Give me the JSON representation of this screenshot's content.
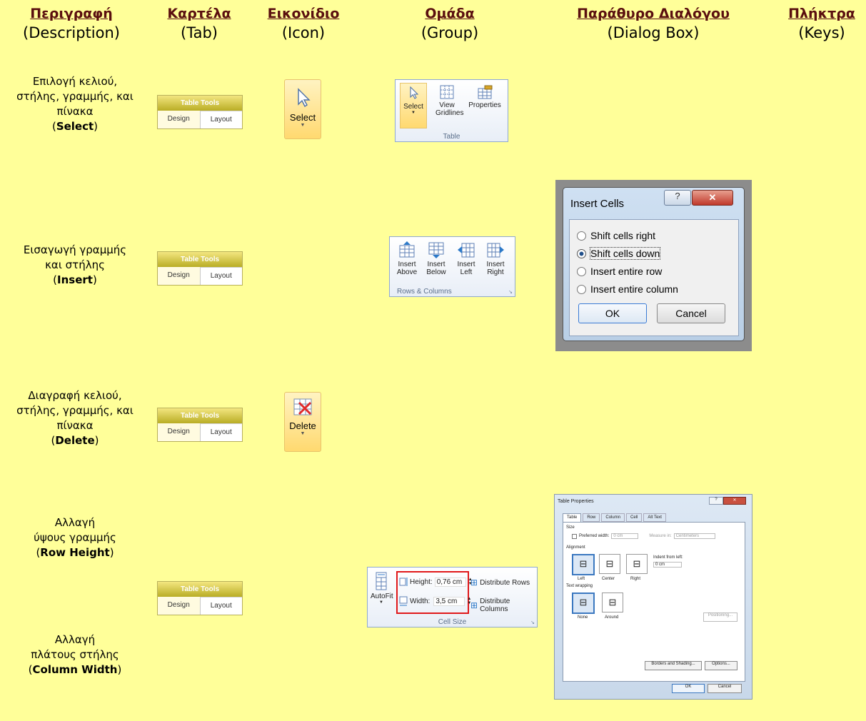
{
  "headers": [
    {
      "title": "Περιγραφή",
      "sub": "(Description)"
    },
    {
      "title": "Καρτέλα",
      "sub": "(Tab)"
    },
    {
      "title": "Εικονίδιο",
      "sub": "(Icon)"
    },
    {
      "title": "Ομάδα",
      "sub": "(Group)"
    },
    {
      "title": "Παράθυρο Διαλόγου",
      "sub": "(Dialog Box)"
    },
    {
      "title": "Πλήκτρα",
      "sub": "(Keys)"
    }
  ],
  "rows": [
    {
      "lines": [
        "Επιλογή κελιού,",
        "στήλης, γραμμής, και",
        "πίνακα"
      ],
      "key": "Select"
    },
    {
      "lines": [
        "Εισαγωγή γραμμής",
        "και στήλης"
      ],
      "key": "Insert"
    },
    {
      "lines": [
        "Διαγραφή κελιού,",
        "στήλης, γραμμής, και",
        "πίνακα"
      ],
      "key": "Delete"
    },
    {
      "lines": [
        "Αλλαγή",
        "ύψους γραμμής"
      ],
      "key": "Row Height"
    },
    {
      "lines": [
        "Αλλαγή",
        "πλάτους στήλης"
      ],
      "key": "Column Width"
    }
  ],
  "tab_tools": {
    "title": "Table Tools",
    "design": "Design",
    "layout": "Layout"
  },
  "icons": {
    "select": "Select",
    "delete": "Delete"
  },
  "group_table": {
    "buttons": [
      "Select",
      "View Gridlines",
      "Properties"
    ],
    "label": "Table"
  },
  "group_rows": {
    "buttons": [
      [
        "Insert",
        "Above"
      ],
      [
        "Insert",
        "Below"
      ],
      [
        "Insert",
        "Left"
      ],
      [
        "Insert",
        "Right"
      ]
    ],
    "label": "Rows & Columns"
  },
  "group_cellsize": {
    "autofit": "AutoFit",
    "height_label": "Height:",
    "height_value": "0,76 cm",
    "width_label": "Width:",
    "width_value": "3,5 cm",
    "dist_rows": "Distribute Rows",
    "dist_cols": "Distribute Columns",
    "label": "Cell Size"
  },
  "insert_cells": {
    "title": "Insert Cells",
    "options": [
      "Shift cells right",
      "Shift cells down",
      "Insert entire row",
      "Insert entire column"
    ],
    "selected": 1,
    "ok": "OK",
    "cancel": "Cancel"
  },
  "table_props": {
    "title": "Table Properties",
    "tabs": [
      "Table",
      "Row",
      "Column",
      "Cell",
      "Alt Text"
    ],
    "size": "Size",
    "preferred": "Preferred width:",
    "pw_value": "0 cm",
    "measure": "Measure in:",
    "measure_value": "Centimeters",
    "alignment": "Alignment",
    "align_opts": [
      "Left",
      "Center",
      "Right"
    ],
    "indent": "Indent from left:",
    "indent_value": "0 cm",
    "wrapping": "Text wrapping",
    "wrap_opts": [
      "None",
      "Around"
    ],
    "positioning": "Positioning...",
    "borders": "Borders and Shading...",
    "options": "Options...",
    "ok": "OK",
    "cancel": "Cancel"
  }
}
